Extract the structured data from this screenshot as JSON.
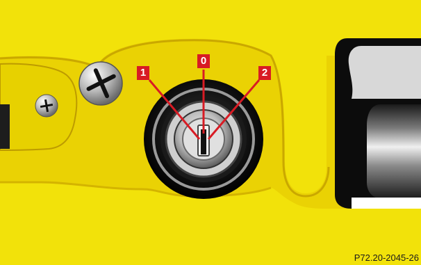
{
  "diagram": {
    "positions": [
      {
        "id": "pos-1",
        "label": "1"
      },
      {
        "id": "pos-0",
        "label": "0"
      },
      {
        "id": "pos-2",
        "label": "2"
      }
    ],
    "reference_code": "P72.20-2045-26"
  },
  "colors": {
    "panel_yellow": "#f2e20a",
    "panel_shadow": "#c9a800",
    "label_red": "#d81b24"
  }
}
